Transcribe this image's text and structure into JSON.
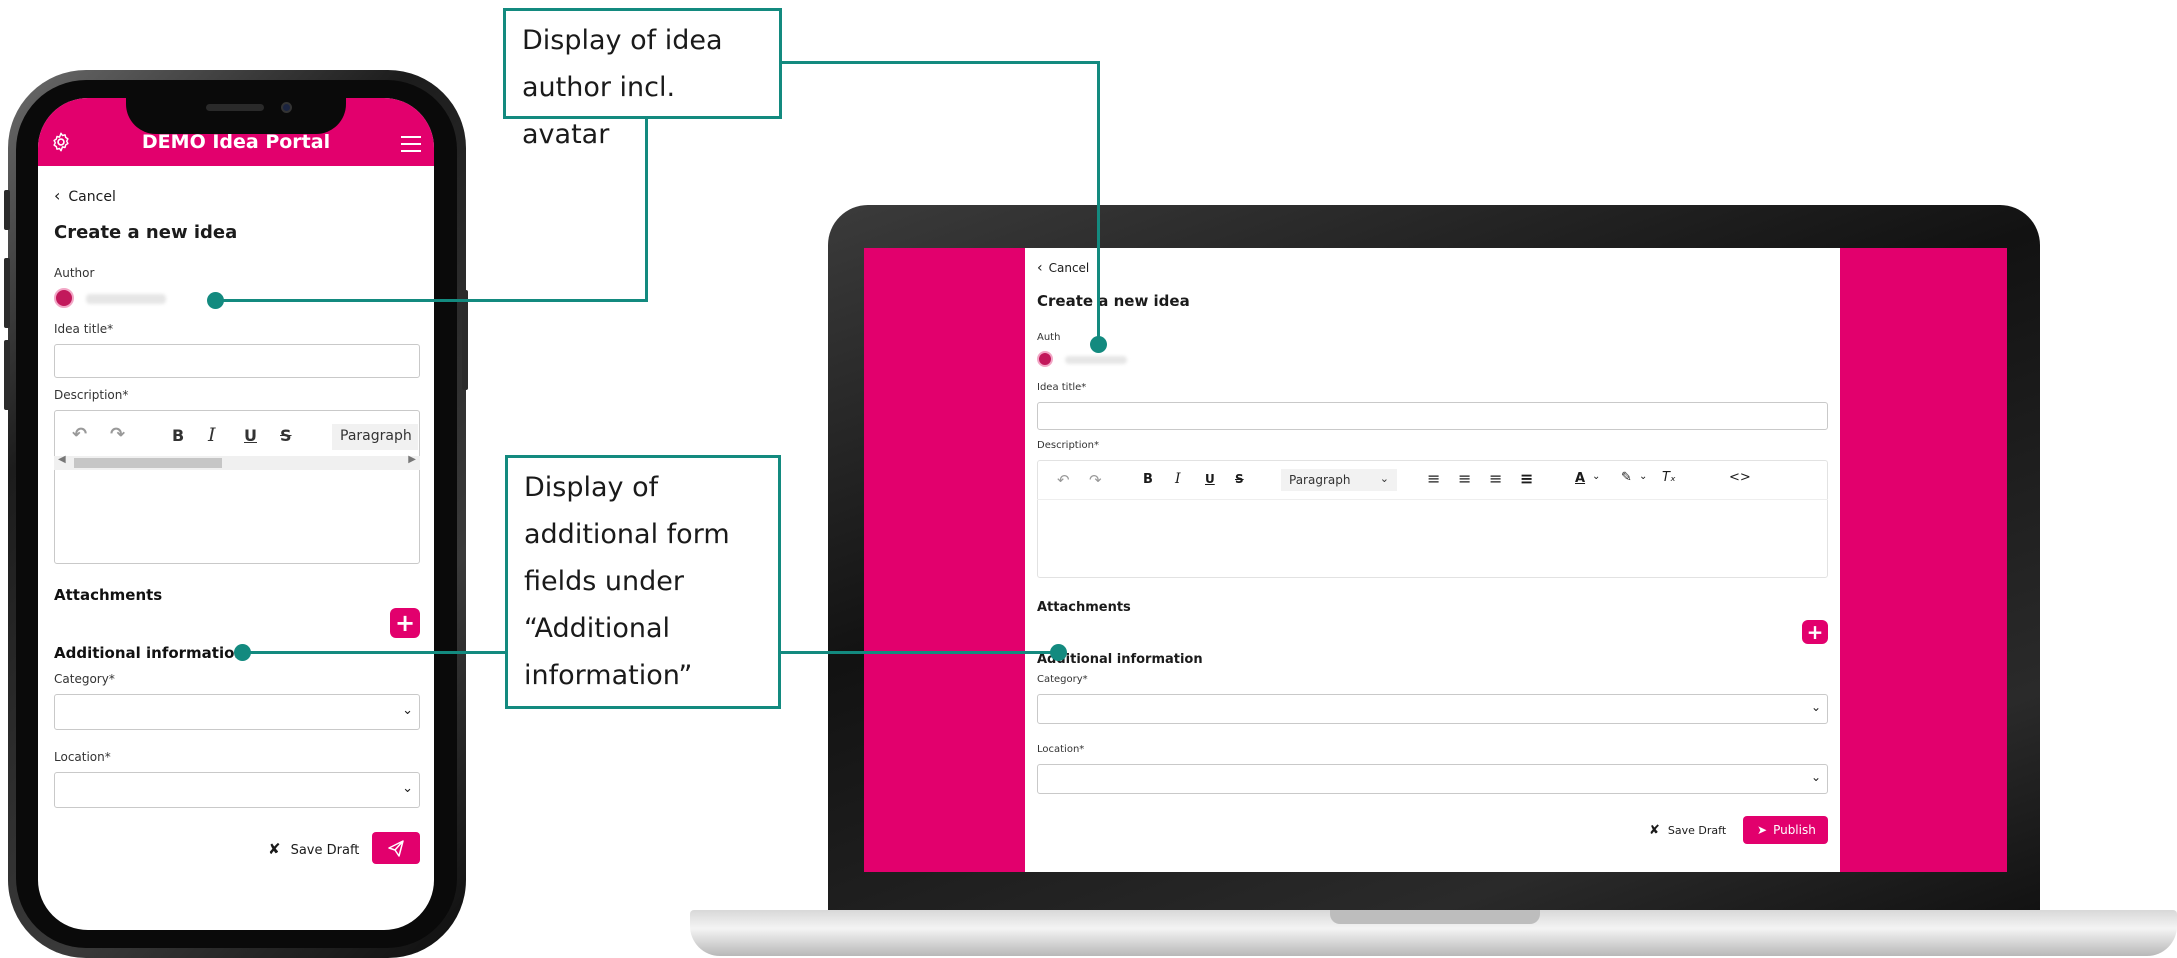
{
  "form": {
    "cancel": "Cancel",
    "heading": "Create a new idea",
    "author_label_phone": "Author",
    "author_label_laptop": "Auth",
    "idea_title_label": "Idea title*",
    "description_label": "Description*",
    "paragraph_select": "Paragraph",
    "attachments_label": "Attachments",
    "additional_info_label": "Additional information",
    "category_label": "Category*",
    "location_label": "Location*",
    "save_draft": "Save Draft",
    "publish": "Publish"
  },
  "phone": {
    "app_title": "DEMO Idea Portal"
  },
  "callouts": {
    "author": [
      "Display of idea",
      "author incl. avatar"
    ],
    "additional": [
      "Display of",
      "additional form",
      "fields under",
      "“Additional",
      "information”"
    ]
  },
  "colors": {
    "brand": "#e2006d",
    "callout": "#138a7f"
  }
}
